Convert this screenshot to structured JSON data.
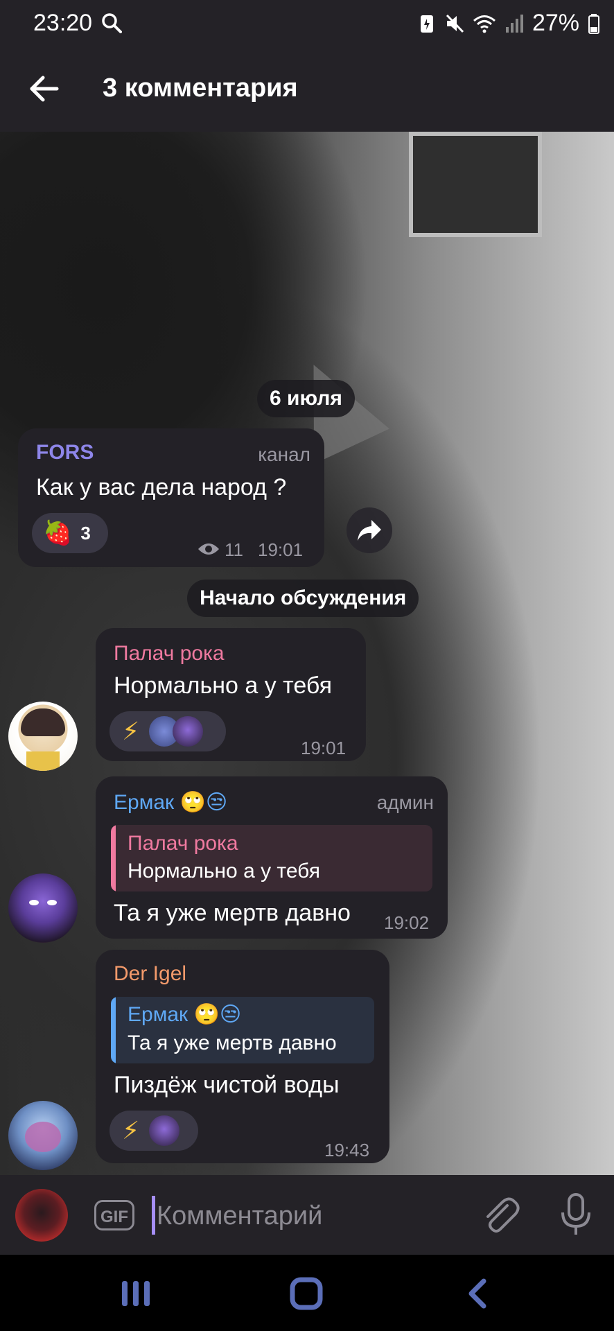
{
  "status_bar": {
    "time": "23:20",
    "battery": "27%"
  },
  "header": {
    "title": "3 комментария"
  },
  "date_pill": "6 июля",
  "discussion_pill": "Начало обсуждения",
  "channel_post": {
    "author": "FORS",
    "badge": "канал",
    "text": "Как у вас дела народ ?",
    "reaction_emoji": "🍓",
    "reaction_count": "3",
    "views": "11",
    "time": "19:01"
  },
  "comments": [
    {
      "author": "Палач рока",
      "author_color": "#f07aa0",
      "text": "Нормально а у тебя",
      "reaction_emoji": "⚡",
      "time": "19:01"
    },
    {
      "author": "Ермак 🙄😒",
      "author_color": "#5fa8f5",
      "badge": "админ",
      "reply_author": "Палач рока",
      "reply_text": "Нормально а у тебя",
      "text": "Та я уже мертв давно",
      "time": "19:02"
    },
    {
      "author": "Der Igel",
      "author_color": "#f39a6b",
      "reply_author": "Ермак 🙄😒",
      "reply_text": "Та я уже мертв давно",
      "text": "Пиздёж чистой воды",
      "reaction_emoji": "⚡",
      "time": "19:43"
    }
  ],
  "composer": {
    "gif_label": "GIF",
    "placeholder": "Комментарий"
  },
  "colors": {
    "accent": "#8e86ea",
    "bubble": "#232127",
    "bar": "#242227"
  }
}
